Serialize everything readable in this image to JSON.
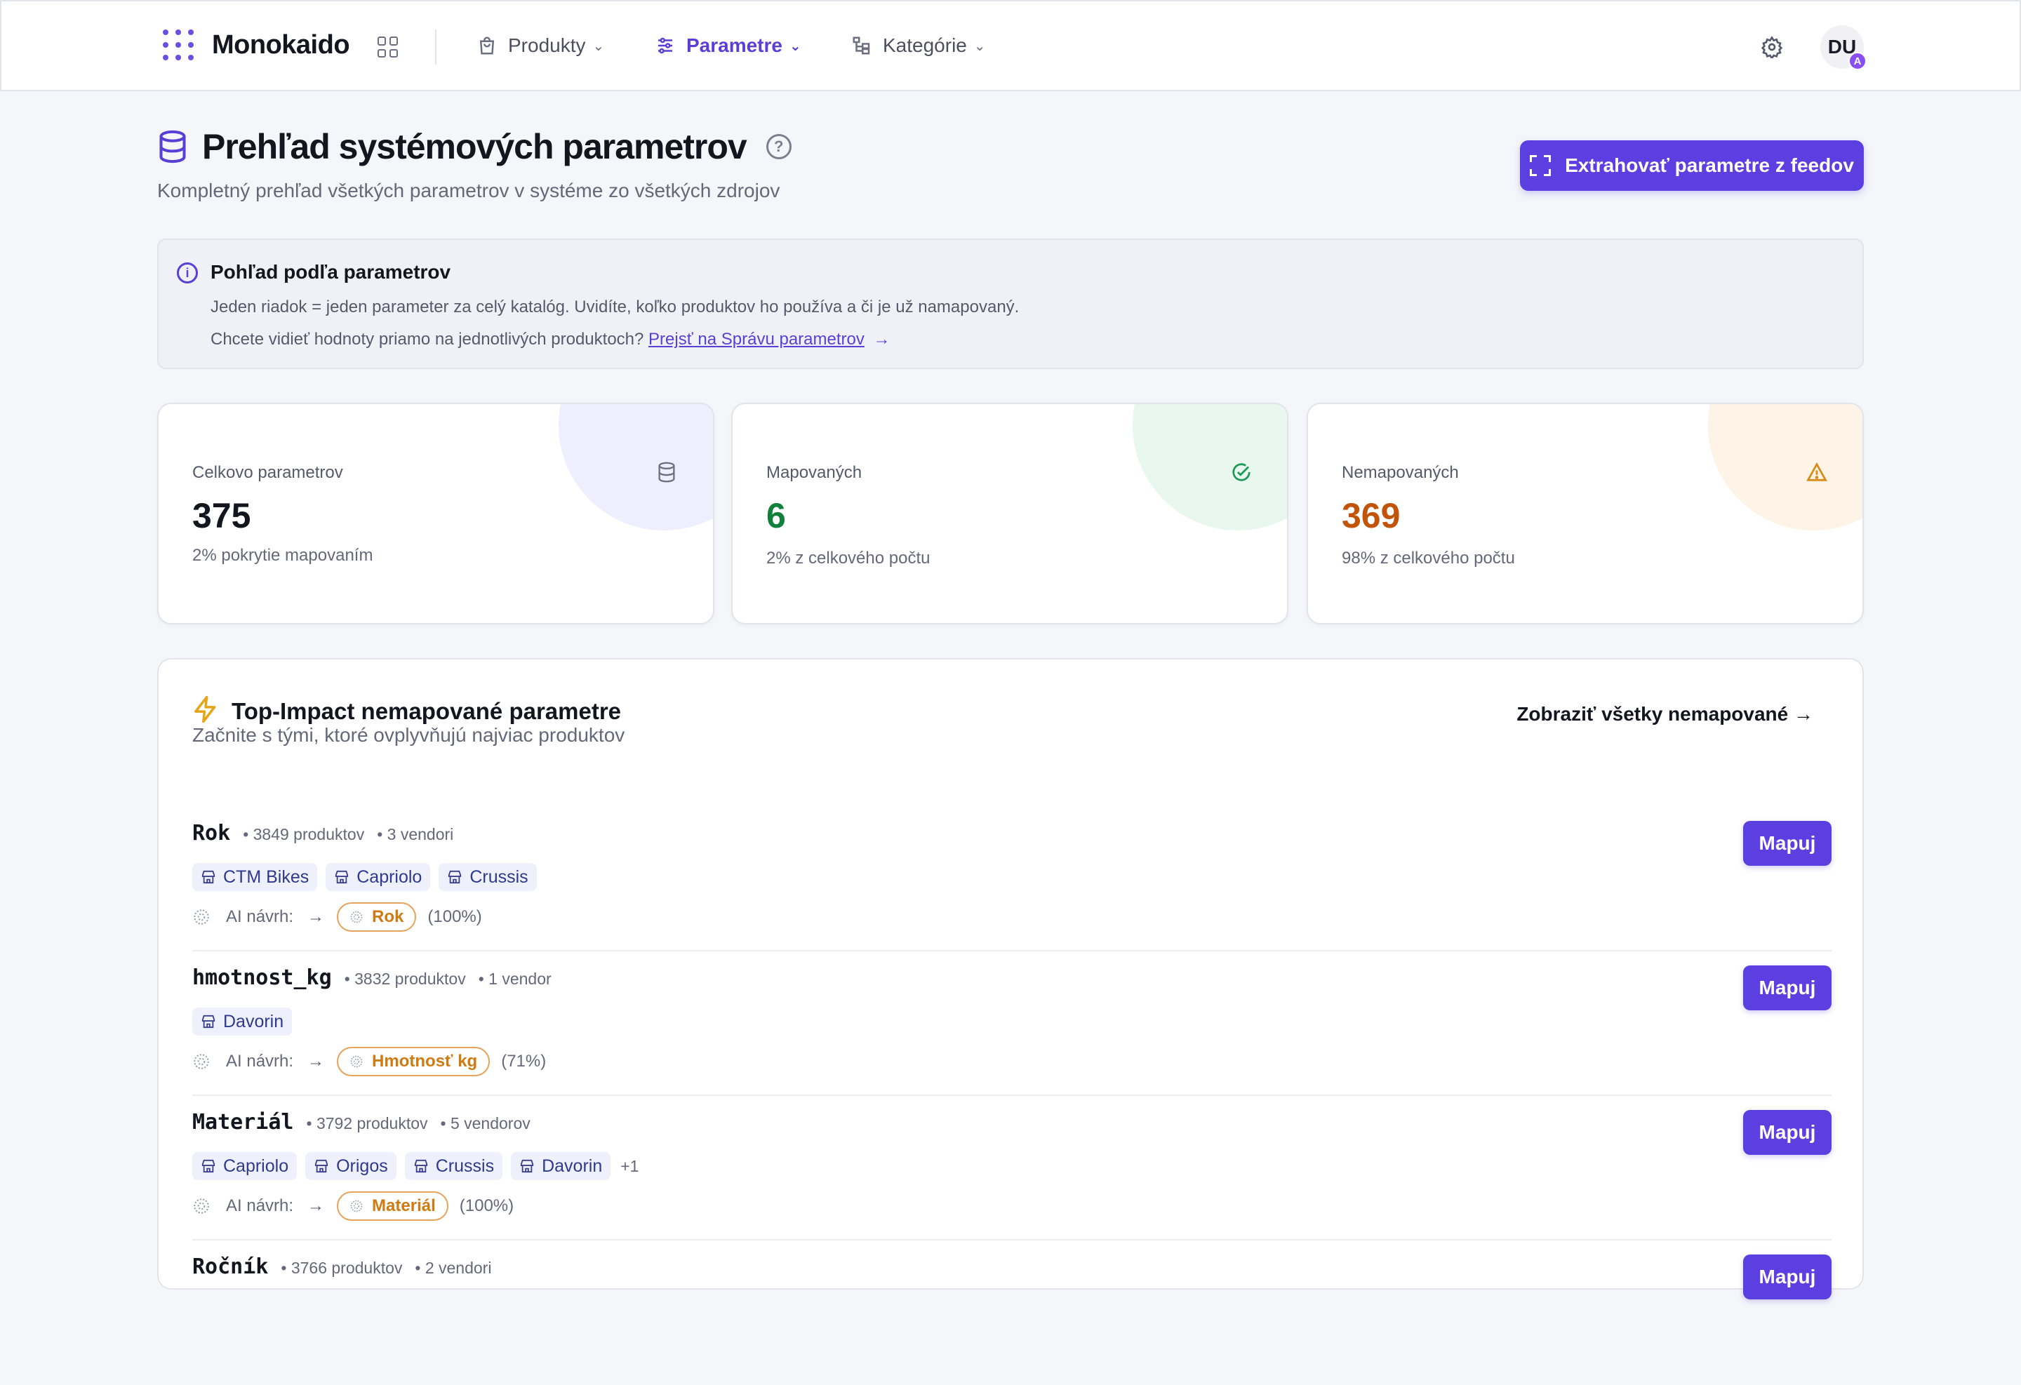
{
  "brand": {
    "name": "Monokaido"
  },
  "nav": {
    "items": [
      {
        "label": "Produkty",
        "icon": "shopping-bag-icon"
      },
      {
        "label": "Parametre",
        "icon": "sliders-icon",
        "active": true
      },
      {
        "label": "Kategórie",
        "icon": "category-tree-icon"
      }
    ]
  },
  "user": {
    "initials": "DU",
    "badge": "A"
  },
  "header": {
    "title": "Prehľad systémových parametrov",
    "subtitle": "Kompletný prehľad všetkých parametrov v systéme zo všetkých zdrojov",
    "extract_button": "Extrahovať parametre z feedov"
  },
  "info": {
    "title": "Pohľad podľa parametrov",
    "line1": "Jeden riadok = jeden parameter za celý katalóg. Uvidíte, koľko produktov ho používa a či je už namapovaný.",
    "line2_text": "Chcete vidieť hodnoty priamo na jednotlivých produktoch?",
    "line2_link": "Prejsť na Správu parametrov"
  },
  "stats": [
    {
      "label": "Celkovo parametrov",
      "value": "375",
      "note": "2% pokrytie mapovaním",
      "value_color": "#15151f",
      "blob": "#efeefe",
      "icon": "database-icon"
    },
    {
      "label": "Mapovaných",
      "value": "6",
      "note": "2% z celkového počtu",
      "value_color": "#12803d",
      "blob": "#e9f8ef",
      "icon": "check-circle-icon"
    },
    {
      "label": "Nemapovaných",
      "value": "369",
      "note": "98% z celkového počtu",
      "value_color": "#c2540a",
      "blob": "#fdf3e6",
      "icon": "warning-triangle-icon"
    }
  ],
  "impact": {
    "title": "Top-Impact nemapované parametre",
    "subtitle": "Začnite s tými, ktoré ovplyvňujú najviac produktov",
    "show_all": "Zobraziť všetky nemapované →",
    "ai_label": "AI návrh:",
    "map_label": "Mapuj",
    "rows": [
      {
        "name": "Rok",
        "products": "• 3849 produktov",
        "vendors_count": "• 3 vendori",
        "vendors": [
          "CTM Bikes",
          "Capriolo",
          "Crussis"
        ],
        "more": "",
        "ai": "Rok",
        "pct": "(100%)"
      },
      {
        "name": "hmotnost_kg",
        "products": "• 3832 produktov",
        "vendors_count": "• 1 vendor",
        "vendors": [
          "Davorin"
        ],
        "more": "",
        "ai": "Hmotnosť kg",
        "pct": "(71%)"
      },
      {
        "name": "Materiál",
        "products": "• 3792 produktov",
        "vendors_count": "• 5 vendorov",
        "vendors": [
          "Capriolo",
          "Origos",
          "Crussis",
          "Davorin"
        ],
        "more": "+1",
        "ai": "Materiál",
        "pct": "(100%)"
      },
      {
        "name": "Ročník",
        "products": "• 3766 produktov",
        "vendors_count": "• 2 vendori",
        "vendors": [],
        "more": "",
        "ai": "",
        "pct": ""
      }
    ]
  }
}
